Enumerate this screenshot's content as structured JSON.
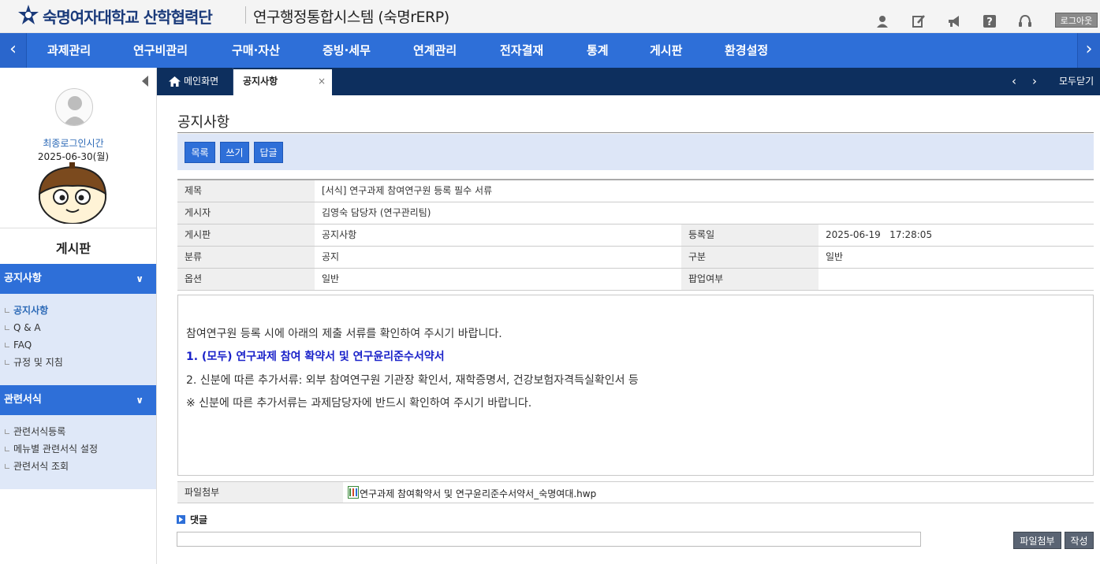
{
  "header": {
    "org_name": "숙명여자대학교 산학협력단",
    "system_name": "연구행정통합시스템 (숙명rERP)",
    "icons": [
      "user-icon",
      "edit-icon",
      "megaphone-icon",
      "help-icon",
      "headset-icon"
    ],
    "logout": "로그아웃"
  },
  "nav": {
    "items": [
      "과제관리",
      "연구비관리",
      "구매·자산",
      "증빙·세무",
      "연계관리",
      "전자결재",
      "통계",
      "게시판",
      "환경설정"
    ],
    "prev_label": "‹",
    "next_label": "›"
  },
  "sidebar": {
    "last_login_label": "최종로그인시간",
    "last_login_value": "2025-06-30(월)",
    "title": "게시판",
    "sections": [
      {
        "label": "공지사항",
        "items": [
          "공지사항",
          "Q & A",
          "FAQ",
          "규정 및 지침"
        ]
      },
      {
        "label": "관련서식",
        "items": [
          "관련서식등록",
          "메뉴별 관련서식 설정",
          "관련서식 조회"
        ]
      }
    ]
  },
  "tabs": {
    "home": "메인화면",
    "active": "공지사항",
    "close_symbol": "×",
    "close_all": "모두닫기"
  },
  "page": {
    "title": "공지사항",
    "buttons": {
      "list": "목록",
      "write": "쓰기",
      "reply": "답글"
    }
  },
  "post": {
    "subject_label": "제목",
    "subject": "[서식] 연구과제 참여연구원 등록 필수 서류",
    "author_label": "게시자",
    "author": "김영숙 담당자 (연구관리팀)",
    "board_label": "게시판",
    "board": "공지사항",
    "regdate_label": "등록일",
    "regdate": "2025-06-19   17:28:05",
    "category_label": "분류",
    "category": "공지",
    "type_label": "구분",
    "type": "일반",
    "option_label": "옵션",
    "option": "일반",
    "popup_label": "팝업여부",
    "popup": ""
  },
  "content": {
    "lines": [
      "참여연구원 등록 시에 아래의 제출 서류를 확인하여 주시기 바랍니다.",
      "1. (모두) 연구과제 참여 확약서 및 연구윤리준수서약서",
      "2. 신분에 따른 추가서류: 외부 참여연구원 기관장 확인서, 재학증명서, 건강보험자격득실확인서 등",
      "※ 신분에 따른 추가서류는 과제담당자에 반드시 확인하여 주시기 바랍니다."
    ]
  },
  "attachment": {
    "label": "파일첨부",
    "file": "연구과제 참여확약서 및 연구윤리준수서약서_숙명여대.hwp"
  },
  "comment": {
    "label": "댓글",
    "attach_button": "파일첨부",
    "submit_button": "작성"
  },
  "colors": {
    "nav_blue": "#2e6fd8",
    "tab_bar": "#0d2f5e",
    "highlight_text": "#1a22c9"
  }
}
